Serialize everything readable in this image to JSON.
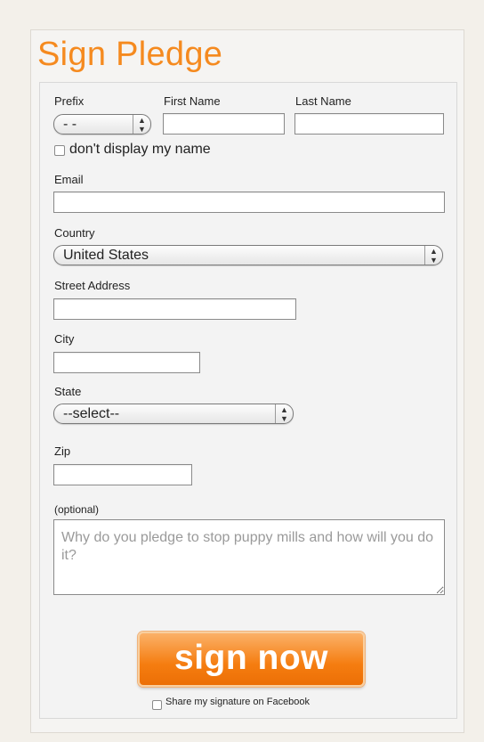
{
  "title": "Sign Pledge",
  "labels": {
    "prefix": "Prefix",
    "first_name": "First Name",
    "last_name": "Last Name",
    "dont_display": "don't display my name",
    "email": "Email",
    "country": "Country",
    "street": "Street Address",
    "city": "City",
    "state": "State",
    "zip": "Zip",
    "optional": "(optional)"
  },
  "selects": {
    "prefix_value": "- -",
    "country_value": "United States",
    "state_value": "--select--"
  },
  "textarea": {
    "placeholder": "Why do you pledge to stop puppy mills and how will you do it?"
  },
  "submit_label": "sign now",
  "facebook_label": "Share my signature on Facebook",
  "colors": {
    "accent": "#f58a1f",
    "button": "#f57d10"
  },
  "icons": {
    "select_arrows": "updown-arrows-icon"
  }
}
